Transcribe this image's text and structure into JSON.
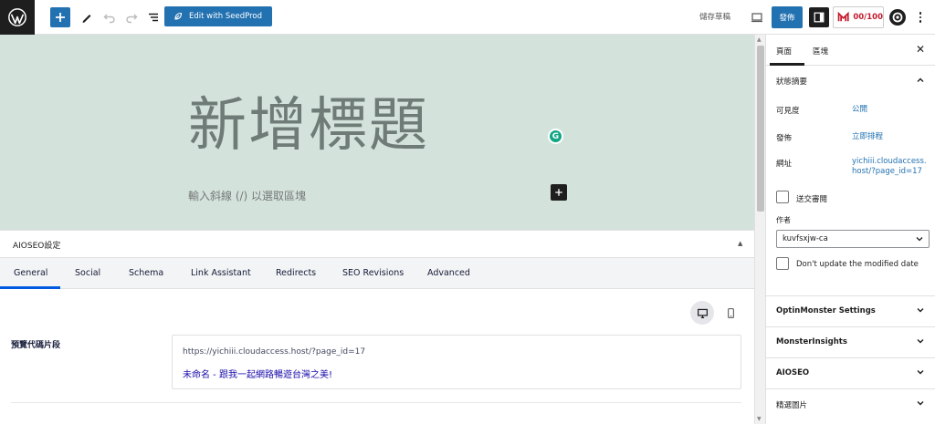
{
  "toolbar": {
    "seedprod_label": "Edit with SeedProd",
    "save_draft": "儲存草稿",
    "publish": "發佈",
    "aioseo_score": "00/100"
  },
  "canvas": {
    "title": "新增標題",
    "placeholder": "輸入斜線 (/) 以選取區塊",
    "grammarly_letter": "G"
  },
  "aioseo": {
    "header_title": "AIOSEO設定",
    "tabs": [
      {
        "label": "General"
      },
      {
        "label": "Social"
      },
      {
        "label": "Schema"
      },
      {
        "label": "Link Assistant"
      },
      {
        "label": "Redirects"
      },
      {
        "label": "SEO Revisions"
      },
      {
        "label": "Advanced"
      }
    ],
    "snippet_label": "預覽代碼片段",
    "snippet_url": "https://yichiii.cloudaccess.host/?page_id=17",
    "snippet_title": "未命名 - 跟我一起網路暢遊台灣之美!"
  },
  "sidebar": {
    "tabs": [
      {
        "label": "頁面"
      },
      {
        "label": "區塊"
      }
    ],
    "summary_title": "狀態摘要",
    "visibility_label": "可見度",
    "visibility_value": "公開",
    "publish_label": "發佈",
    "publish_value": "立即排程",
    "url_label": "網址",
    "url_value_1": "yichiii.cloudaccess.",
    "url_value_2": "host/?page_id=17",
    "pending_review": "送交審閱",
    "author_label": "作者",
    "author_value": "kuvfsxjw-ca",
    "dont_update": "Don't update the modified date",
    "panels": [
      {
        "label": "OptinMonster Settings"
      },
      {
        "label": "MonsterInsights"
      },
      {
        "label": "AIOSEO"
      },
      {
        "label": "精選圖片"
      }
    ]
  },
  "colors": {
    "accent": "#2271b1",
    "canvas_bg": "#d3e3dc",
    "aioseo_tab_active": "#005ae0",
    "snippet_title": "#1a0dab",
    "score_red": "#c11a2c"
  }
}
